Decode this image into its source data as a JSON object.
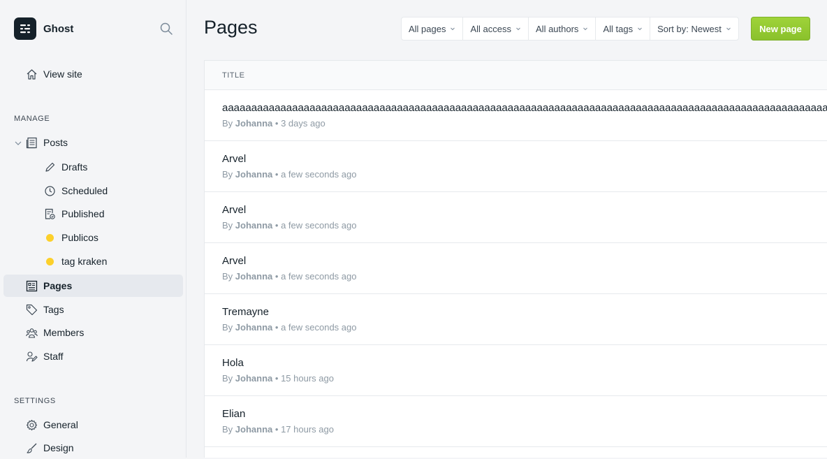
{
  "brand": {
    "name": "Ghost"
  },
  "nav": {
    "view_site": "View site",
    "manage_label": "MANAGE",
    "posts": "Posts",
    "drafts": "Drafts",
    "scheduled": "Scheduled",
    "published": "Published",
    "publicos": "Publicos",
    "tag_kraken": "tag kraken",
    "pages": "Pages",
    "tags": "Tags",
    "members": "Members",
    "staff": "Staff",
    "settings_label": "SETTINGS",
    "general": "General",
    "design": "Design"
  },
  "colors": {
    "tag_dot": "#fcd02b",
    "accent_green": "#8ac12c"
  },
  "header": {
    "title": "Pages",
    "filters": [
      "All pages",
      "All access",
      "All authors",
      "All tags",
      "Sort by: Newest"
    ],
    "new_button": "New page"
  },
  "table": {
    "column_title": "TITLE",
    "rows": [
      {
        "title": "aaaaaaaaaaaaaaaaaaaaaaaaaaaaaaaaaaaaaaaaaaaaaaaaaaaaaaaaaaaaaaaaaaaaaaaaaaaaaaaaaaaaaaaaaaaaaaaaaaaaaaaaaa",
        "by": "By",
        "author": "Johanna",
        "sep": "•",
        "time": "3 days ago"
      },
      {
        "title": "Arvel",
        "by": "By",
        "author": "Johanna",
        "sep": "•",
        "time": "a few seconds ago"
      },
      {
        "title": "Arvel",
        "by": "By",
        "author": "Johanna",
        "sep": "•",
        "time": "a few seconds ago"
      },
      {
        "title": "Arvel",
        "by": "By",
        "author": "Johanna",
        "sep": "•",
        "time": "a few seconds ago"
      },
      {
        "title": "Tremayne",
        "by": "By",
        "author": "Johanna",
        "sep": "•",
        "time": "a few seconds ago"
      },
      {
        "title": "Hola",
        "by": "By",
        "author": "Johanna",
        "sep": "•",
        "time": "15 hours ago"
      },
      {
        "title": "Elian",
        "by": "By",
        "author": "Johanna",
        "sep": "•",
        "time": "17 hours ago"
      }
    ]
  }
}
